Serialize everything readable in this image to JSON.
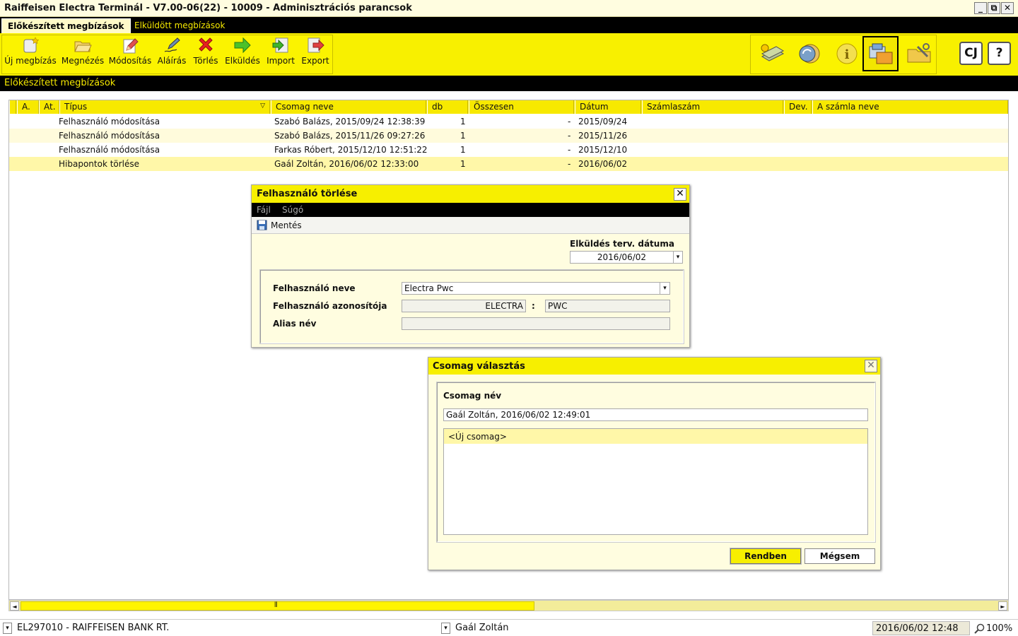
{
  "window": {
    "title": "Raiffeisen Electra Terminál - V7.00-06(22) - 10009 - Adminisztrációs parancsok",
    "min": "_",
    "restore": "⧉",
    "close": "✕"
  },
  "tabs": [
    "Előkészített megbízások",
    "Elküldött megbízások"
  ],
  "toolbar": {
    "buttons": [
      {
        "label": "Új megbízás",
        "icon": "new-order-icon"
      },
      {
        "label": "Megnézés",
        "icon": "folder-open-icon"
      },
      {
        "label": "Módosítás",
        "icon": "edit-icon"
      },
      {
        "label": "Aláírás",
        "icon": "sign-pen-icon"
      },
      {
        "label": "Törlés",
        "icon": "delete-x-icon"
      },
      {
        "label": "Elküldés",
        "icon": "send-arrow-icon"
      },
      {
        "label": "Import",
        "icon": "import-icon"
      },
      {
        "label": "Export",
        "icon": "export-icon"
      }
    ],
    "right_icons": [
      "money-icon",
      "currency-exchange-icon",
      "info-icon",
      "admin-icon",
      "folder-tools-icon"
    ],
    "fullscreen": "CJ",
    "help": "?"
  },
  "section_title": "Előkészített megbízások",
  "table": {
    "headers": [
      "A.",
      "At.",
      "Típus",
      "Csomag neve",
      "db",
      "Összesen",
      "Dátum",
      "Számlaszám",
      "Dev.",
      "A számla neve"
    ],
    "sort_indicator": "▽",
    "rows": [
      {
        "tipus": "Felhasználó módosítása",
        "csomag": "Szabó Balázs, 2015/09/24 12:38:39",
        "db": "1",
        "osszesen": "-",
        "datum": "2015/09/24"
      },
      {
        "tipus": "Felhasználó módosítása",
        "csomag": "Szabó Balázs, 2015/11/26 09:27:26",
        "db": "1",
        "osszesen": "-",
        "datum": "2015/11/26"
      },
      {
        "tipus": "Felhasználó módosítása",
        "csomag": "Farkas Róbert, 2015/12/10 12:51:22",
        "db": "1",
        "osszesen": "-",
        "datum": "2015/12/10"
      },
      {
        "tipus": "Hibapontok törlése",
        "csomag": "Gaál Zoltán, 2016/06/02 12:33:00",
        "db": "1",
        "osszesen": "-",
        "datum": "2016/06/02"
      }
    ]
  },
  "scroll": {
    "left": "◄",
    "right": "►",
    "grip": "⦀"
  },
  "dialog_user_delete": {
    "title": "Felhasználó törlése",
    "close": "✕",
    "menu": [
      "Fájl",
      "Súgó"
    ],
    "save": "Mentés",
    "send_date_label": "Elküldés terv. dátuma",
    "send_date": "2016/06/02",
    "user_name_label": "Felhasználó neve",
    "user_name": "Electra Pwc",
    "user_id_label": "Felhasználó azonosítója",
    "user_id_1": "ELECTRA",
    "separator": ":",
    "user_id_2": "PWC",
    "alias_label": "Alias név",
    "alias": ""
  },
  "dialog_package": {
    "title": "Csomag választás",
    "close": "✕",
    "name_label": "Csomag név",
    "name_value": "Gaál Zoltán, 2016/06/02 12:49:01",
    "list": [
      "<Új csomag>"
    ],
    "ok": "Rendben",
    "cancel": "Mégsem"
  },
  "statusbar": {
    "bank": "EL297010 - RAIFFEISEN BANK RT.",
    "user": "Gaál Zoltán",
    "datetime": "2016/06/02 12:48",
    "zoom": "100%",
    "dd_arrow": "▾"
  },
  "colors": {
    "accent_yellow": "#f7ef00",
    "dark": "#000000",
    "pale_yellow": "#fffde0"
  }
}
